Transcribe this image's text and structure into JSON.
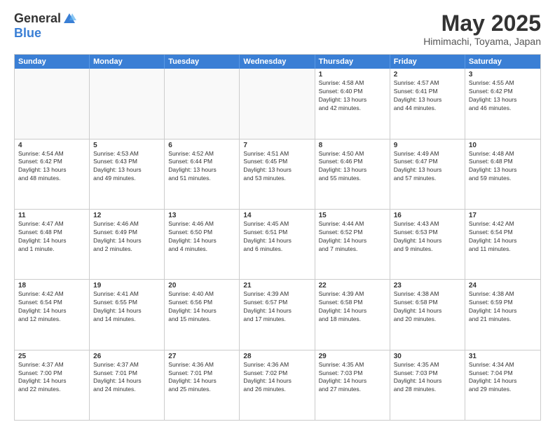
{
  "logo": {
    "general": "General",
    "blue": "Blue"
  },
  "title": "May 2025",
  "location": "Himimachi, Toyama, Japan",
  "weekdays": [
    "Sunday",
    "Monday",
    "Tuesday",
    "Wednesday",
    "Thursday",
    "Friday",
    "Saturday"
  ],
  "rows": [
    [
      {
        "day": "",
        "info": "",
        "empty": true
      },
      {
        "day": "",
        "info": "",
        "empty": true
      },
      {
        "day": "",
        "info": "",
        "empty": true
      },
      {
        "day": "",
        "info": "",
        "empty": true
      },
      {
        "day": "1",
        "info": "Sunrise: 4:58 AM\nSunset: 6:40 PM\nDaylight: 13 hours\nand 42 minutes."
      },
      {
        "day": "2",
        "info": "Sunrise: 4:57 AM\nSunset: 6:41 PM\nDaylight: 13 hours\nand 44 minutes."
      },
      {
        "day": "3",
        "info": "Sunrise: 4:55 AM\nSunset: 6:42 PM\nDaylight: 13 hours\nand 46 minutes."
      }
    ],
    [
      {
        "day": "4",
        "info": "Sunrise: 4:54 AM\nSunset: 6:42 PM\nDaylight: 13 hours\nand 48 minutes."
      },
      {
        "day": "5",
        "info": "Sunrise: 4:53 AM\nSunset: 6:43 PM\nDaylight: 13 hours\nand 49 minutes."
      },
      {
        "day": "6",
        "info": "Sunrise: 4:52 AM\nSunset: 6:44 PM\nDaylight: 13 hours\nand 51 minutes."
      },
      {
        "day": "7",
        "info": "Sunrise: 4:51 AM\nSunset: 6:45 PM\nDaylight: 13 hours\nand 53 minutes."
      },
      {
        "day": "8",
        "info": "Sunrise: 4:50 AM\nSunset: 6:46 PM\nDaylight: 13 hours\nand 55 minutes."
      },
      {
        "day": "9",
        "info": "Sunrise: 4:49 AM\nSunset: 6:47 PM\nDaylight: 13 hours\nand 57 minutes."
      },
      {
        "day": "10",
        "info": "Sunrise: 4:48 AM\nSunset: 6:48 PM\nDaylight: 13 hours\nand 59 minutes."
      }
    ],
    [
      {
        "day": "11",
        "info": "Sunrise: 4:47 AM\nSunset: 6:48 PM\nDaylight: 14 hours\nand 1 minute."
      },
      {
        "day": "12",
        "info": "Sunrise: 4:46 AM\nSunset: 6:49 PM\nDaylight: 14 hours\nand 2 minutes."
      },
      {
        "day": "13",
        "info": "Sunrise: 4:46 AM\nSunset: 6:50 PM\nDaylight: 14 hours\nand 4 minutes."
      },
      {
        "day": "14",
        "info": "Sunrise: 4:45 AM\nSunset: 6:51 PM\nDaylight: 14 hours\nand 6 minutes."
      },
      {
        "day": "15",
        "info": "Sunrise: 4:44 AM\nSunset: 6:52 PM\nDaylight: 14 hours\nand 7 minutes."
      },
      {
        "day": "16",
        "info": "Sunrise: 4:43 AM\nSunset: 6:53 PM\nDaylight: 14 hours\nand 9 minutes."
      },
      {
        "day": "17",
        "info": "Sunrise: 4:42 AM\nSunset: 6:54 PM\nDaylight: 14 hours\nand 11 minutes."
      }
    ],
    [
      {
        "day": "18",
        "info": "Sunrise: 4:42 AM\nSunset: 6:54 PM\nDaylight: 14 hours\nand 12 minutes."
      },
      {
        "day": "19",
        "info": "Sunrise: 4:41 AM\nSunset: 6:55 PM\nDaylight: 14 hours\nand 14 minutes."
      },
      {
        "day": "20",
        "info": "Sunrise: 4:40 AM\nSunset: 6:56 PM\nDaylight: 14 hours\nand 15 minutes."
      },
      {
        "day": "21",
        "info": "Sunrise: 4:39 AM\nSunset: 6:57 PM\nDaylight: 14 hours\nand 17 minutes."
      },
      {
        "day": "22",
        "info": "Sunrise: 4:39 AM\nSunset: 6:58 PM\nDaylight: 14 hours\nand 18 minutes."
      },
      {
        "day": "23",
        "info": "Sunrise: 4:38 AM\nSunset: 6:58 PM\nDaylight: 14 hours\nand 20 minutes."
      },
      {
        "day": "24",
        "info": "Sunrise: 4:38 AM\nSunset: 6:59 PM\nDaylight: 14 hours\nand 21 minutes."
      }
    ],
    [
      {
        "day": "25",
        "info": "Sunrise: 4:37 AM\nSunset: 7:00 PM\nDaylight: 14 hours\nand 22 minutes."
      },
      {
        "day": "26",
        "info": "Sunrise: 4:37 AM\nSunset: 7:01 PM\nDaylight: 14 hours\nand 24 minutes."
      },
      {
        "day": "27",
        "info": "Sunrise: 4:36 AM\nSunset: 7:01 PM\nDaylight: 14 hours\nand 25 minutes."
      },
      {
        "day": "28",
        "info": "Sunrise: 4:36 AM\nSunset: 7:02 PM\nDaylight: 14 hours\nand 26 minutes."
      },
      {
        "day": "29",
        "info": "Sunrise: 4:35 AM\nSunset: 7:03 PM\nDaylight: 14 hours\nand 27 minutes."
      },
      {
        "day": "30",
        "info": "Sunrise: 4:35 AM\nSunset: 7:03 PM\nDaylight: 14 hours\nand 28 minutes."
      },
      {
        "day": "31",
        "info": "Sunrise: 4:34 AM\nSunset: 7:04 PM\nDaylight: 14 hours\nand 29 minutes."
      }
    ]
  ]
}
